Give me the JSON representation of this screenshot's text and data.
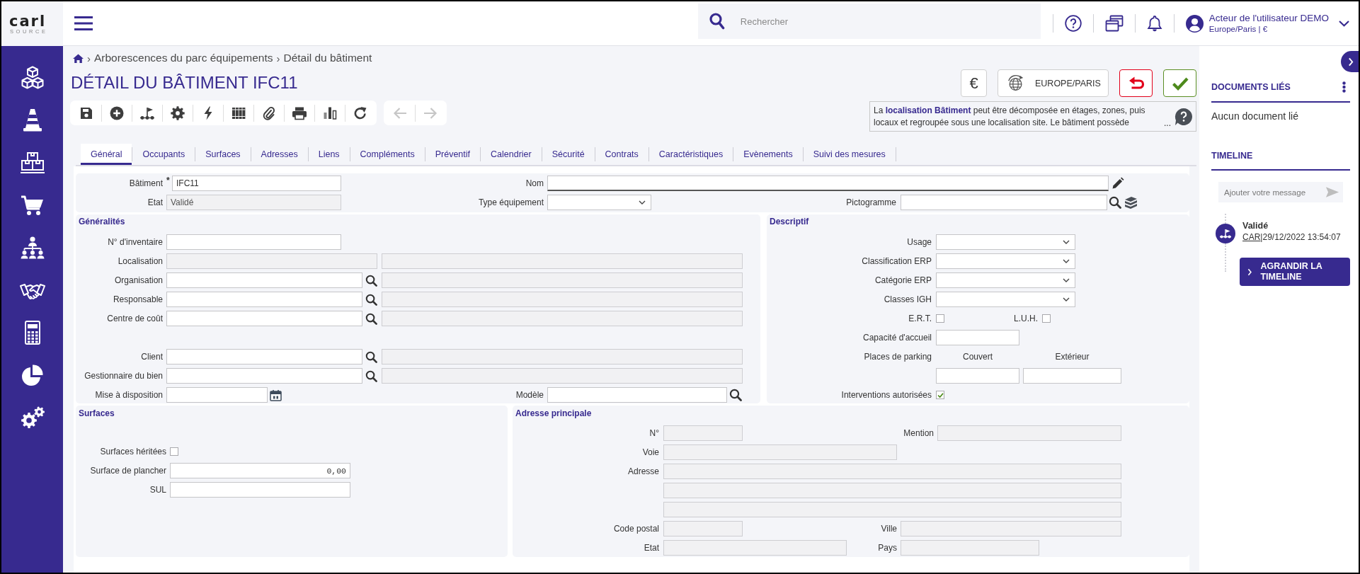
{
  "header": {
    "logo": {
      "wordmark": "carl",
      "tagline": "SOURCE"
    },
    "search": {
      "placeholder": "Rechercher"
    },
    "user": {
      "name": "Acteur de l'utilisateur DEMO",
      "details": "Europe/Paris | €"
    }
  },
  "breadcrumb": [
    {
      "separator": "›",
      "label": "Arborescences du parc équipements"
    },
    {
      "separator": "›",
      "label": "Détail du bâtiment"
    }
  ],
  "title": "DÉTAIL DU BÂTIMENT IFC11",
  "navigation": {
    "back": {
      "disabled": true
    },
    "forward": {
      "disabled": true
    }
  },
  "actions": {
    "currency": "€",
    "timezone": "EUROPE/PARIS"
  },
  "info": {
    "text": "La **localisation Bâtiment** peut être décomposée en étages, zones, puis locaux et regroupée sous une localisation site. Le bâtiment possède",
    "more": "..."
  },
  "tabs": [
    {
      "label": "Général",
      "selected": true
    },
    {
      "label": "Occupants",
      "selected": false
    },
    {
      "label": "Surfaces",
      "selected": false
    },
    {
      "label": "Adresses",
      "selected": false
    },
    {
      "label": "Liens",
      "selected": false
    },
    {
      "label": "Compléments",
      "selected": false
    },
    {
      "label": "Préventif",
      "selected": false
    },
    {
      "label": "Calendrier",
      "selected": false
    },
    {
      "label": "Sécurité",
      "selected": false
    },
    {
      "label": "Contrats",
      "selected": false
    },
    {
      "label": "Caractéristiques",
      "selected": false
    },
    {
      "label": "Evènements",
      "selected": false
    },
    {
      "label": "Suivi des mesures",
      "selected": false
    }
  ],
  "identity": {
    "building": {
      "label": "Bâtiment",
      "required_mark": "*",
      "value": "IFC11",
      "disabled": false
    },
    "state": {
      "label": "Etat",
      "value": "Validé",
      "disabled": true
    },
    "name": {
      "label": "Nom",
      "disabled": false,
      "focused": true
    },
    "equipment_type": {
      "label": "Type équipement",
      "disabled": false
    },
    "pictogram": {
      "label": "Pictogramme",
      "disabled": false
    }
  },
  "general": {
    "title": "Généralités",
    "rows": [
      {
        "label": "N° d'inventaire",
        "fields": [
          {
            "kind": "text",
            "disabled": false
          }
        ]
      },
      {
        "label": "Localisation",
        "fields": [
          {
            "kind": "text",
            "disabled": true
          },
          {
            "kind": "text",
            "disabled": true
          }
        ]
      },
      {
        "label": "Organisation",
        "fields": [
          {
            "kind": "lookup",
            "disabled": false
          },
          {
            "kind": "text",
            "disabled": true
          }
        ]
      },
      {
        "label": "Responsable",
        "fields": [
          {
            "kind": "lookup",
            "disabled": false
          },
          {
            "kind": "text",
            "disabled": true
          }
        ]
      },
      {
        "label": "Centre de coût",
        "fields": [
          {
            "kind": "lookup",
            "disabled": false
          },
          {
            "kind": "text",
            "disabled": true
          }
        ]
      },
      {
        "label": "Client",
        "fields": [
          {
            "kind": "lookup",
            "disabled": false
          },
          {
            "kind": "text",
            "disabled": true
          }
        ]
      },
      {
        "label": "Gestionnaire du bien",
        "fields": [
          {
            "kind": "lookup",
            "disabled": false
          },
          {
            "kind": "text",
            "disabled": true
          }
        ]
      },
      {
        "label": "Mise à disposition",
        "fields": [
          {
            "kind": "date",
            "disabled": false
          }
        ],
        "aside": {
          "label": "Modèle",
          "kind": "lookup",
          "disabled": false
        }
      }
    ]
  },
  "descriptive": {
    "title": "Descriptif",
    "selects": [
      {
        "label": "Usage",
        "disabled": false
      },
      {
        "label": "Classification ERP",
        "disabled": false
      },
      {
        "label": "Catégorie ERP",
        "disabled": false
      },
      {
        "label": "Classes IGH",
        "disabled": false
      }
    ],
    "flags": [
      {
        "label": "E.R.T.",
        "checked": false
      },
      {
        "label": "L.U.H.",
        "checked": false
      }
    ],
    "capacity": {
      "label": "Capacité d'accueil",
      "disabled": false
    },
    "parking": {
      "label": "Places de parking",
      "columns": [
        {
          "label": "Couvert",
          "disabled": false
        },
        {
          "label": "Extérieur",
          "disabled": false
        }
      ]
    },
    "interventions": {
      "label": "Interventions autorisées",
      "checked": true
    }
  },
  "surfaces": {
    "title": "Surfaces",
    "inherited": {
      "label": "Surfaces héritées",
      "checked": false
    },
    "floor_area": {
      "label": "Surface de plancher",
      "value": "0,00",
      "disabled": false
    },
    "sul": {
      "label": "SUL",
      "disabled": false
    }
  },
  "address": {
    "title": "Adresse principale",
    "number": {
      "label": "N°",
      "disabled": true
    },
    "mention": {
      "label": "Mention",
      "disabled": true
    },
    "street": {
      "label": "Voie",
      "disabled": true
    },
    "address": {
      "label": "Adresse",
      "lines": [
        {
          "disabled": true
        },
        {
          "disabled": true
        },
        {
          "disabled": true
        }
      ]
    },
    "postal_code": {
      "label": "Code postal",
      "disabled": true
    },
    "city": {
      "label": "Ville",
      "disabled": true
    },
    "state": {
      "label": "Etat",
      "disabled": true
    },
    "country": {
      "label": "Pays",
      "disabled": true
    }
  },
  "side_panel": {
    "documents": {
      "title": "DOCUMENTS LIÉS",
      "empty": "Aucun document lié"
    },
    "timeline": {
      "title": "TIMELINE",
      "message": {
        "placeholder": "Ajouter votre message"
      },
      "events": [
        {
          "title": "Validé",
          "author": "CAR",
          "separator": "|",
          "date": "29/12/2022 13:54:07"
        }
      ],
      "expand": "AGRANDIR LA TIMELINE"
    }
  }
}
